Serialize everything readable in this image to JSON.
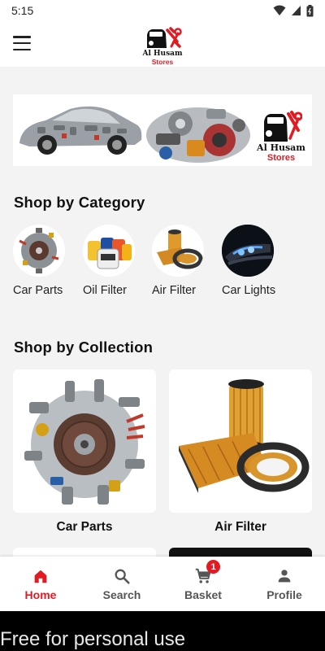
{
  "status_bar": {
    "time": "5:15"
  },
  "header": {
    "logo_name": "Al Husam",
    "logo_sub": "Stores"
  },
  "banner": {
    "logo_name": "Al Husam",
    "logo_sub": "Stores"
  },
  "categories_section": {
    "title": "Shop by Category",
    "items": [
      {
        "label": "Car Parts"
      },
      {
        "label": "Oil Filter"
      },
      {
        "label": "Air Filter"
      },
      {
        "label": "Car Lights"
      }
    ]
  },
  "collection_section": {
    "title": "Shop by Collection",
    "items": [
      {
        "label": "Car Parts"
      },
      {
        "label": "Air Filter"
      }
    ]
  },
  "bottom_nav": {
    "items": [
      {
        "label": "Home",
        "icon": "home-icon",
        "active": true
      },
      {
        "label": "Search",
        "icon": "search-icon"
      },
      {
        "label": "Basket",
        "icon": "cart-icon",
        "badge": "1"
      },
      {
        "label": "Profile",
        "icon": "person-icon"
      }
    ]
  },
  "watermark": "Free for personal use",
  "colors": {
    "accent": "#e21b23",
    "background": "#f3f3f3",
    "muted_nav": "#555555"
  }
}
